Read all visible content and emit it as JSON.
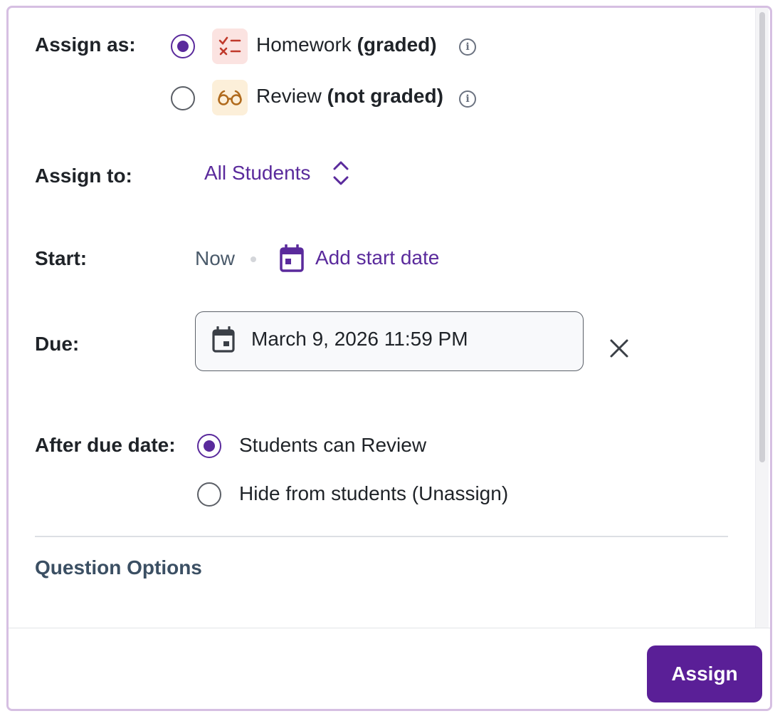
{
  "assign_as": {
    "label": "Assign as:",
    "options": [
      {
        "name": "Homework",
        "bold": "(graded)",
        "checked": true,
        "icon": "checklist-icon"
      },
      {
        "name": "Review",
        "bold": "(not graded)",
        "checked": false,
        "icon": "glasses-icon"
      }
    ]
  },
  "assign_to": {
    "label": "Assign to:",
    "value": "All Students"
  },
  "start": {
    "label": "Start:",
    "value": "Now",
    "add_label": "Add start date"
  },
  "due": {
    "label": "Due:",
    "value": "March 9, 2026 11:59 PM"
  },
  "after_due": {
    "label": "After due date:",
    "options": [
      {
        "text": "Students can Review",
        "checked": true
      },
      {
        "text": "Hide from students (Unassign)",
        "checked": false
      }
    ]
  },
  "question_options": {
    "title": "Question Options"
  },
  "footer": {
    "assign_label": "Assign"
  },
  "colors": {
    "accent": "#5a1f97",
    "radio_selected": "#5a2a9c",
    "homework_icon_bg": "#fbe3e1",
    "review_icon_bg": "#fcefd9"
  }
}
